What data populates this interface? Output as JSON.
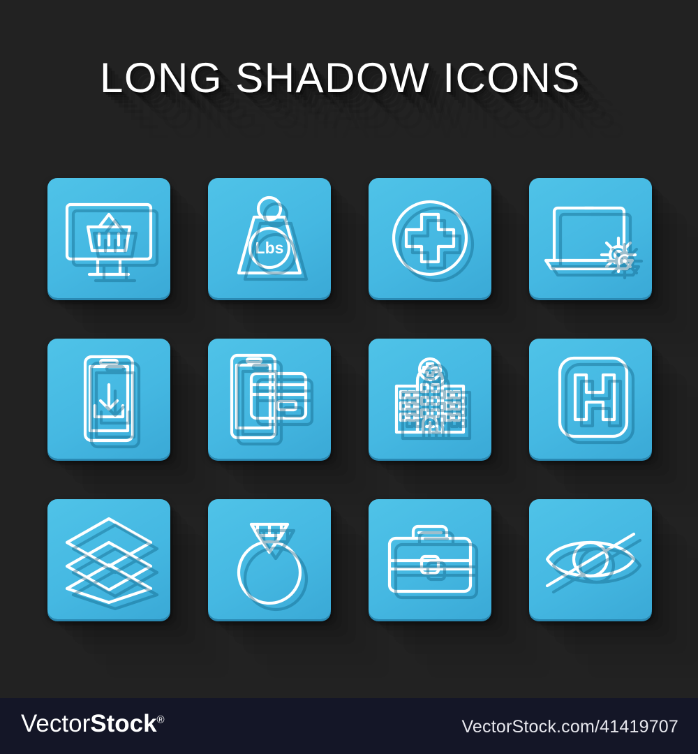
{
  "page": {
    "title": "LONG SHADOW ICONS",
    "background_color": "#222222",
    "tile_color": "#45b8e2",
    "glyph_color": "#ffffff"
  },
  "grid": {
    "columns": 4,
    "rows": 3,
    "tiles": [
      {
        "icon": "monitor-shopping-basket-icon",
        "label": "Online shopping on monitor"
      },
      {
        "icon": "weight-lbs-icon",
        "label": "Weight Lbs",
        "text": "Lbs"
      },
      {
        "icon": "medical-cross-circle-icon",
        "label": "Cross hospital sign in circle"
      },
      {
        "icon": "laptop-gear-icon",
        "label": "Laptop settings"
      },
      {
        "icon": "smartphone-download-icon",
        "label": "Smartphone download"
      },
      {
        "icon": "smartphone-credit-card-icon",
        "label": "Mobile payment by credit card"
      },
      {
        "icon": "hospital-building-icon",
        "label": "Medical hospital building"
      },
      {
        "icon": "hospital-h-sign-icon",
        "label": "Hospital sign letter H",
        "text": "H"
      },
      {
        "icon": "layers-icon",
        "label": "Layers"
      },
      {
        "icon": "diamond-ring-icon",
        "label": "Diamond engagement ring"
      },
      {
        "icon": "briefcase-icon",
        "label": "Briefcase"
      },
      {
        "icon": "eye-slash-icon",
        "label": "Invisible / hidden eye"
      }
    ]
  },
  "footer": {
    "logo_light": "Vector",
    "logo_bold": "Stock",
    "logo_registered": "®",
    "url": "VectorStock.com/41419707",
    "background_color": "#141627"
  }
}
